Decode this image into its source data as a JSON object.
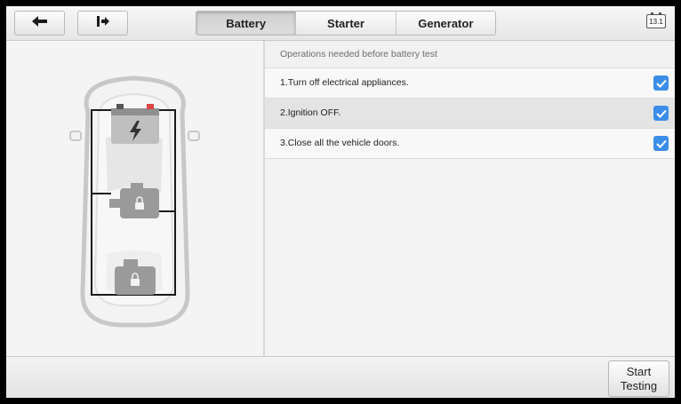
{
  "toolbar": {
    "back_icon": "back-arrow-icon",
    "exit_icon": "exit-icon",
    "battery_status": "13.1"
  },
  "tabs": [
    {
      "label": "Battery",
      "active": true
    },
    {
      "label": "Starter",
      "active": false
    },
    {
      "label": "Generator",
      "active": false
    }
  ],
  "checklist": {
    "header": "Operations needed before battery test",
    "items": [
      {
        "label": "1.Turn off electrical appliances.",
        "checked": true
      },
      {
        "label": "2.Ignition OFF.",
        "checked": true
      },
      {
        "label": "3.Close all the vehicle doors.",
        "checked": true
      }
    ]
  },
  "bottom": {
    "start_line1": "Start",
    "start_line2": "Testing"
  },
  "colors": {
    "accent": "#3b8ee8"
  }
}
